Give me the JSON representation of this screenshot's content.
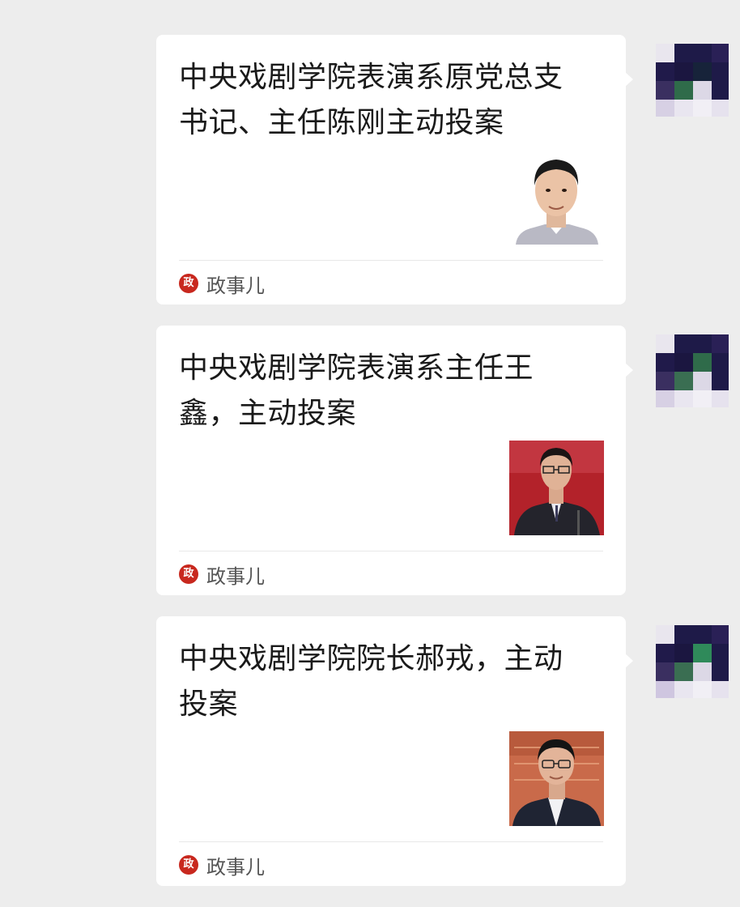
{
  "messages": [
    {
      "title": "中央戏剧学院表演系原党总支书记、主任陈刚主动投案",
      "source": "政事儿",
      "logo_text": "政",
      "photo": "portrait-photo-1"
    },
    {
      "title": "中央戏剧学院表演系主任王鑫，主动投案",
      "source": "政事儿",
      "logo_text": "政",
      "photo": "portrait-photo-2"
    },
    {
      "title": "中央戏剧学院院长郝戎，主动投案",
      "source": "政事儿",
      "logo_text": "政",
      "photo": "portrait-photo-3"
    }
  ],
  "colors": {
    "background": "#ededed",
    "bubble": "#ffffff",
    "logo_red": "#c8281e",
    "avatar_dark": "#1e1a48",
    "avatar_green": "#2f6b4a"
  }
}
